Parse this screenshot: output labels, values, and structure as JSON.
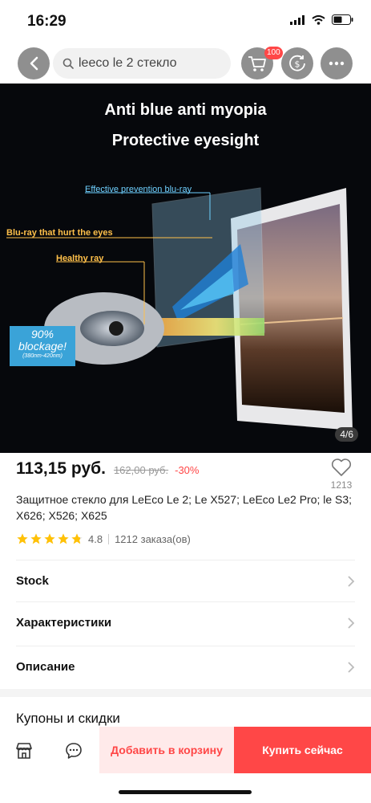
{
  "status_bar": {
    "time": "16:29"
  },
  "nav": {
    "search_text": "leeco le 2 стекло",
    "cart_badge": "100"
  },
  "hero": {
    "title_line1": "Anti blue anti myopia",
    "title_line2": "Protective eyesight",
    "label_prevention": "Effective prevention blu-ray",
    "label_hurt": "Blu-ray that hurt the eyes",
    "label_healthy": "Healthy ray",
    "blockage_pct": "90%",
    "blockage_word": "blockage!",
    "blockage_range": "(380nm-420nm)",
    "page_counter": "4/6"
  },
  "product": {
    "price": "113,15 руб.",
    "old_price": "162,00 руб.",
    "discount": "-30%",
    "wishlist_count": "1213",
    "title": "Защитное стекло для LeEco Le 2; Le X527; LeEco Le2 Pro; le S3; X626; X526; X625",
    "rating": "4.8",
    "orders": "1212 заказа(ов)"
  },
  "sections": {
    "stock": "Stock",
    "specs": "Характеристики",
    "description": "Описание",
    "coupons": "Купоны и скидки"
  },
  "bottom_bar": {
    "add_to_cart": "Добавить в корзину",
    "buy_now": "Купить сейчас"
  },
  "colors": {
    "accent": "#ff4747",
    "star": "#ffc107"
  },
  "icons": [
    "signal-icon",
    "wifi-icon",
    "battery-icon",
    "back-icon",
    "search-icon",
    "cart-icon",
    "coin-icon",
    "more-icon",
    "heart-icon",
    "star-icon",
    "chevron-right-icon",
    "store-icon",
    "chat-icon"
  ]
}
